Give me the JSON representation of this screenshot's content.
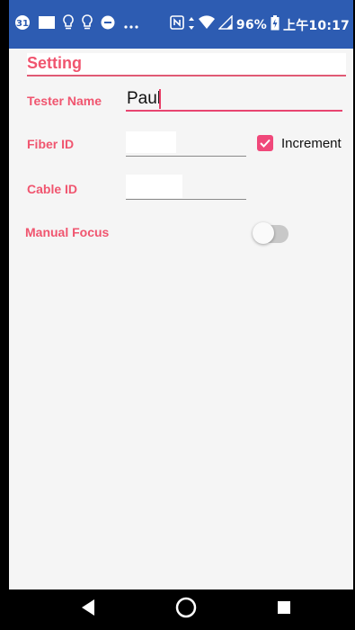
{
  "status_bar": {
    "left_icons": [
      "calendar-icon",
      "image-icon",
      "bulb-icon",
      "bulb-icon",
      "minus-circle-icon",
      "more-icon"
    ],
    "right_icons": [
      "nfc-icon",
      "data-arrows-icon",
      "wifi-icon",
      "signal-icon",
      "battery-icon"
    ],
    "battery": "96%",
    "clock": "上午10:17",
    "color": "#2d5cb2"
  },
  "page": {
    "title": "Setting",
    "accent_color": "#f0556f"
  },
  "form": {
    "tester_name": {
      "label": "Tester Name",
      "value": "Paul"
    },
    "fiber_id": {
      "label": "Fiber ID",
      "value": ""
    },
    "increment": {
      "label": "Increment",
      "checked": true
    },
    "cable_id": {
      "label": "Cable ID",
      "value": ""
    },
    "manual_focus": {
      "label": "Manual Focus",
      "enabled": false
    }
  },
  "nav_bar": {
    "buttons": [
      "back-icon",
      "home-icon",
      "recents-icon"
    ]
  }
}
